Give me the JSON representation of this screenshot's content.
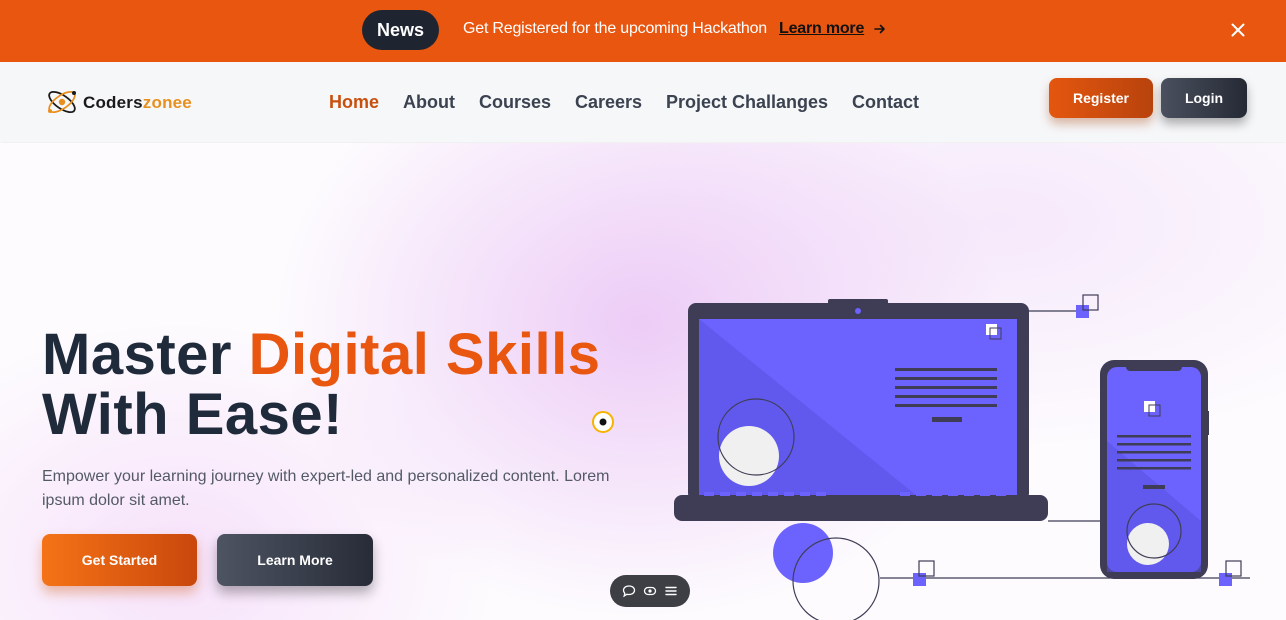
{
  "announcement": {
    "badge": "News",
    "text": "Get Registered for the upcoming Hackathon",
    "link": "Learn more",
    "arrow_icon": "arrow-right-icon",
    "close_icon": "close-icon"
  },
  "header": {
    "logo": {
      "icon": "atom-icon",
      "text_primary": "Coders",
      "text_accent": "zonee"
    },
    "nav": [
      "Home",
      "About",
      "Courses",
      "Careers",
      "Project Challanges",
      "Contact"
    ],
    "active_nav": "Home",
    "register_label": "Register",
    "login_label": "Login"
  },
  "hero": {
    "title_plain_1": "Master ",
    "title_accent": "Digital Skills",
    "title_plain_2": "With Ease!",
    "subtitle": "Empower your learning journey with expert-led and personalized content. Lorem ipsum dolor sit amet.",
    "primary_cta": "Get Started",
    "secondary_cta": "Learn More"
  },
  "floating_toolbar": {
    "icons": [
      "chat-icon",
      "eye-icon",
      "menu-icon"
    ]
  },
  "colors": {
    "brand_orange": "#e8560f",
    "dark": "#1f2530",
    "illustration_purple": "#6c63ff",
    "logo_accent": "#e8901f"
  }
}
